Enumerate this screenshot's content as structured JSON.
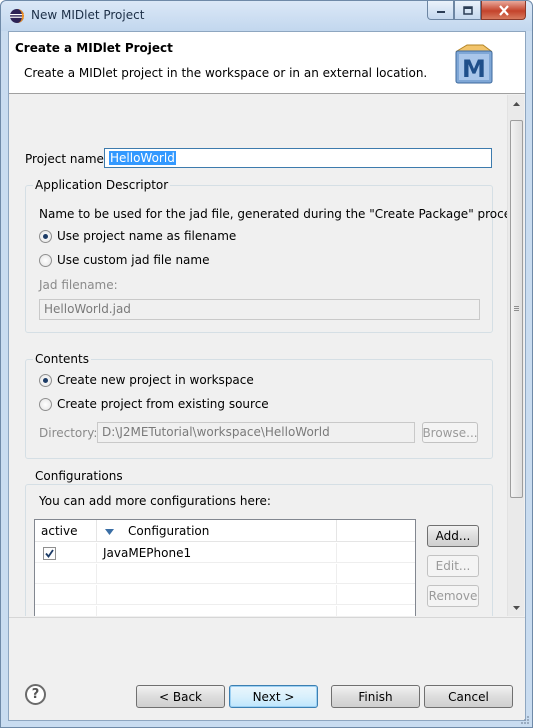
{
  "window": {
    "title": "New MIDlet Project"
  },
  "header": {
    "title": "Create a MIDlet Project",
    "description": "Create a MIDlet project in the workspace or in an external location.",
    "logo_letter": "M"
  },
  "project_name": {
    "label": "Project name:",
    "value": "HelloWorld"
  },
  "app_descriptor": {
    "title": "Application Descriptor",
    "instruction": "Name to be used for the jad file, generated during the \"Create Package\" process:",
    "option_project_name": "Use project name as filename",
    "option_custom": "Use custom jad file name",
    "selected": "project_name",
    "jad_label": "Jad filename:",
    "jad_value": "HelloWorld.jad"
  },
  "contents": {
    "title": "Contents",
    "option_new": "Create new project in workspace",
    "option_existing": "Create project from existing source",
    "selected": "new",
    "directory_label": "Directory:",
    "directory_value": "D:\\J2METutorial\\workspace\\HelloWorld",
    "browse_label": "Browse..."
  },
  "configurations": {
    "title": "Configurations",
    "instruction": "You can add more configurations here:",
    "columns": [
      "active",
      "Configuration"
    ],
    "rows": [
      {
        "active": true,
        "name": "JavaMEPhone1"
      }
    ],
    "add_label": "Add...",
    "edit_label": "Edit...",
    "remove_label": "Remove"
  },
  "footer": {
    "help_symbol": "?",
    "back_label": "< Back",
    "next_label": "Next >",
    "finish_label": "Finish",
    "cancel_label": "Cancel"
  },
  "icons": {
    "app": "eclipse-icon",
    "help": "help-icon",
    "logo": "midlet-project-wizard-icon"
  },
  "colors": {
    "selection": "#3399ff",
    "titlebar": "#c2d7ee",
    "close_button": "#c4432b"
  }
}
